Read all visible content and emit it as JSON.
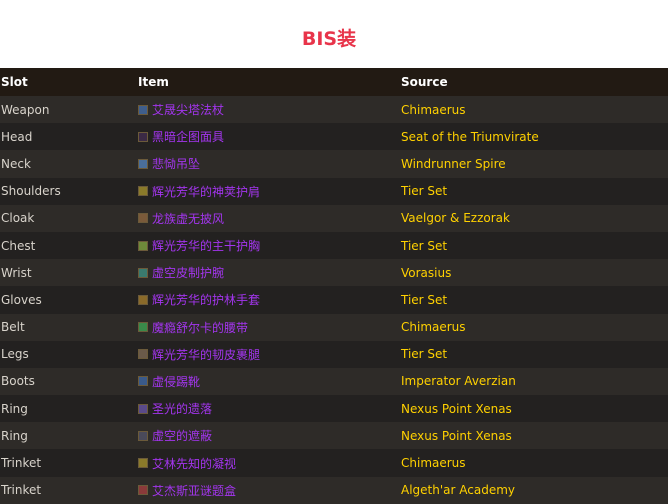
{
  "page_title": "BIS装",
  "table": {
    "headers": {
      "slot": "Slot",
      "item": "Item",
      "source": "Source"
    },
    "rows": [
      {
        "slot": "Weapon",
        "item": "艾晟尖塔法杖",
        "source": "Chimaerus",
        "icon": "staff-icon",
        "icon_color": "#3f5e8c"
      },
      {
        "slot": "Head",
        "item": "黑暗企图面具",
        "source": "Seat of the Triumvirate",
        "icon": "mask-icon",
        "icon_color": "#3b2a45"
      },
      {
        "slot": "Neck",
        "item": "悲恸吊坠",
        "source": "Windrunner Spire",
        "icon": "amulet-icon",
        "icon_color": "#4a6e9a"
      },
      {
        "slot": "Shoulders",
        "item": "辉光芳华的神荚护肩",
        "source": "Tier Set",
        "icon": "shoulder-icon",
        "icon_color": "#8a7a2a"
      },
      {
        "slot": "Cloak",
        "item": "龙族虚无披风",
        "source": "Vaelgor & Ezzorak",
        "icon": "cloak-icon",
        "icon_color": "#7a5a3a"
      },
      {
        "slot": "Chest",
        "item": "辉光芳华的主干护胸",
        "source": "Tier Set",
        "icon": "chest-icon",
        "icon_color": "#6e8a3a"
      },
      {
        "slot": "Wrist",
        "item": "虚空皮制护腕",
        "source": "Vorasius",
        "icon": "bracer-icon",
        "icon_color": "#3a7a6e"
      },
      {
        "slot": "Gloves",
        "item": "辉光芳华的护林手套",
        "source": "Tier Set",
        "icon": "gloves-icon",
        "icon_color": "#8a6a2a"
      },
      {
        "slot": "Belt",
        "item": "魔瘾舒尔卡的腰带",
        "source": "Chimaerus",
        "icon": "belt-icon",
        "icon_color": "#3a8a4a"
      },
      {
        "slot": "Legs",
        "item": "辉光芳华的韧皮裹腿",
        "source": "Tier Set",
        "icon": "legs-icon",
        "icon_color": "#6a5a4a"
      },
      {
        "slot": "Boots",
        "item": "虚侵踢靴",
        "source": "Imperator Averzian",
        "icon": "boots-icon",
        "icon_color": "#3a5a8a"
      },
      {
        "slot": "Ring",
        "item": "圣光的遗落",
        "source": "Nexus Point Xenas",
        "icon": "ring-icon",
        "icon_color": "#5a4a8a"
      },
      {
        "slot": "Ring",
        "item": "虚空的遮蔽",
        "source": "Nexus Point Xenas",
        "icon": "ring-icon",
        "icon_color": "#4a4a5a"
      },
      {
        "slot": "Trinket",
        "item": "艾林先知的凝视",
        "source": "Chimaerus",
        "icon": "trinket-icon",
        "icon_color": "#8a7a2a"
      },
      {
        "slot": "Trinket",
        "item": "艾杰斯亚谜题盒",
        "source": "Algeth'ar Academy",
        "icon": "trinket-icon",
        "icon_color": "#8a3a3a"
      }
    ]
  },
  "colors": {
    "title": "#e8344a",
    "item_epic": "#a335ee",
    "source": "#ffd100",
    "header_bg": "#221a13",
    "row_odd_bg": "#2e2b28",
    "row_even_bg": "#232120"
  }
}
